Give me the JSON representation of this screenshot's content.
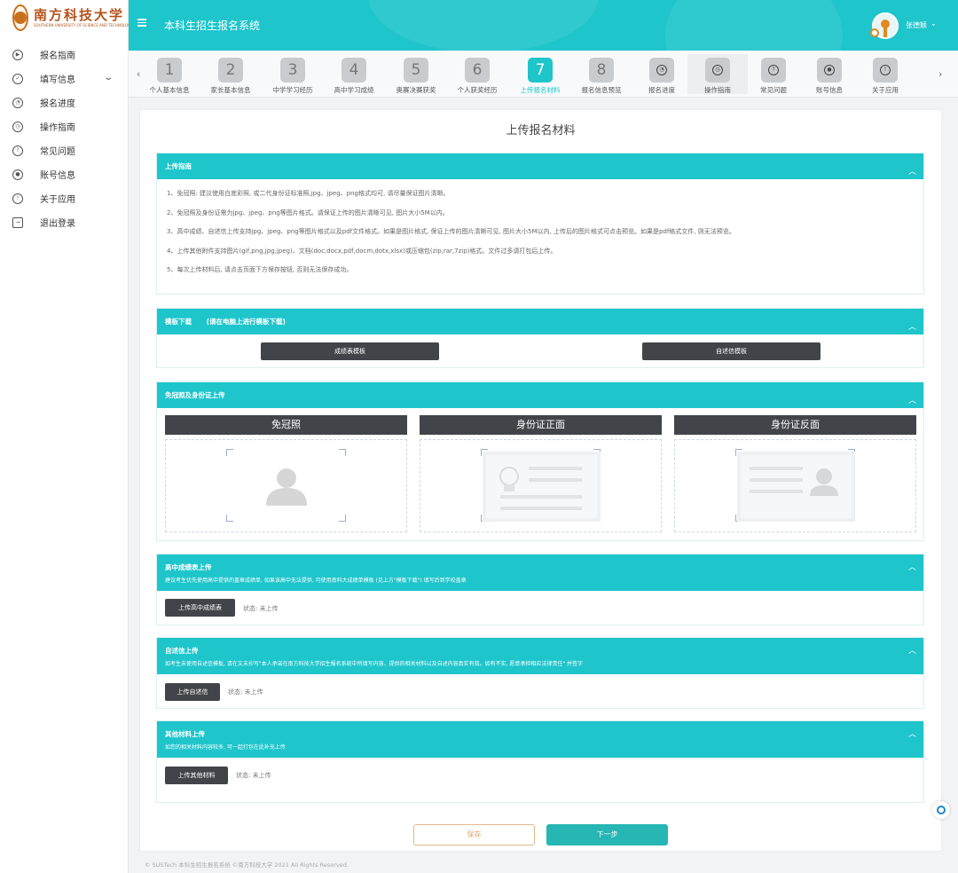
{
  "logo": {
    "name_cn": "南方科技大学",
    "name_en": "SOUTHERN UNIVERSITY OF SCIENCE AND TECHNOLOGY"
  },
  "sidebar": {
    "items": [
      {
        "label": "报名指南",
        "icon": "play-circle-icon"
      },
      {
        "label": "填写信息",
        "icon": "check-circle-icon",
        "has_submenu": true
      },
      {
        "label": "报名进度",
        "icon": "gauge-icon"
      },
      {
        "label": "操作指南",
        "icon": "clock-icon"
      },
      {
        "label": "常见问题",
        "icon": "question-circle-icon"
      },
      {
        "label": "账号信息",
        "icon": "user-circle-icon"
      },
      {
        "label": "关于应用",
        "icon": "info-circle-icon"
      },
      {
        "label": "退出登录",
        "icon": "logout-icon"
      }
    ]
  },
  "header": {
    "title": "本科生招生报名系统",
    "user_name": "张德颖"
  },
  "stepper": {
    "steps": [
      {
        "badge": "1",
        "label": "个人基本信息"
      },
      {
        "badge": "2",
        "label": "家长基本信息"
      },
      {
        "badge": "3",
        "label": "中学学习经历"
      },
      {
        "badge": "4",
        "label": "高中学习成绩"
      },
      {
        "badge": "5",
        "label": "奥赛决赛获奖"
      },
      {
        "badge": "6",
        "label": "个人获奖经历"
      },
      {
        "badge": "7",
        "label": "上传报名材料",
        "active": true
      },
      {
        "badge": "8",
        "label": "报名信息预览"
      },
      {
        "icon": "gauge-icon",
        "label": "报名进度"
      },
      {
        "icon": "clock-icon",
        "label": "操作指南"
      },
      {
        "icon": "question-circle-icon",
        "label": "常见问题"
      },
      {
        "icon": "user-circle-icon",
        "label": "账号信息"
      },
      {
        "icon": "info-circle-icon",
        "label": "关于应用"
      }
    ]
  },
  "page_title": "上传报名材料",
  "guide": {
    "title": "上传指南",
    "lines": [
      "1、免冠照: 建议使用白底彩照, 或二代身份证标准照,jpg、jpeg、png格式均可, 请尽量保证图片清晰。",
      "2、免冠照及身份证需为jpg、jpeg、png等图片格式。请保证上传的图片清晰可见, 图片大小5M以内。",
      "3、高中成绩、自述信上传支持jpg、jpeg、png等图片格式以及pdf文件格式。如果是图片格式, 保证上传的图片清晰可见, 图片大小5M以内, 上传后的图片格式可点击预览。如果是pdf格式文件, 则无法预览。",
      "4、上传其他附件支持图片(gif,png,jpg,jpeg)、文档(doc,docx,pdf,docm,dotx,xlsx)或压缩包(zip,rar,7zip)格式。文件过多请打包后上传。",
      "5、每次上传材料后, 请点击页面下方保存按钮, 否则无法保存成功。"
    ]
  },
  "templates": {
    "title": "模板下载",
    "note": "(请在电脑上进行模板下载)",
    "score_button": "成绩表模板",
    "letter_button": "自述信模板"
  },
  "id_upload": {
    "title": "免冠照及身份证上传",
    "photo_label": "免冠照",
    "front_label": "身份证正面",
    "back_label": "身份证反面"
  },
  "score_upload": {
    "title": "高中成绩表上传",
    "hint": "建议考生优先使用高中提供的盖章成绩单, 如果该高中无法提供, 可使用南科大成绩单模板 (见上方\"模板下载\") 填写后到学校盖章",
    "button": "上传高中成绩表",
    "status": "状态: 未上传"
  },
  "letter_upload": {
    "title": "自述信上传",
    "hint": "如考生未使用自述信模板, 请在文末抄写\"本人承诺在南方科技大学招生报名系统中所填写内容、提供的相关材料以及自述内容真实有效。如有不实, 愿意承担相应法律责任\" 并签字",
    "button": "上传自述信",
    "status": "状态: 未上传"
  },
  "other_upload": {
    "title": "其他材料上传",
    "hint": "如您的相关材料内容较多, 可一起打包在此补充上传",
    "button": "上传其他材料",
    "status": "状态: 未上传"
  },
  "actions": {
    "save": "保存",
    "next": "下一步"
  },
  "footer": "© SUSTech 本科生招生报名系统 ©南方科技大学 2021 All Rights Reserved.",
  "colors": {
    "accent": "#1ec5cb",
    "dark_button": "#414549",
    "save_border": "#e2b98b",
    "next_button": "#26b6b4"
  }
}
